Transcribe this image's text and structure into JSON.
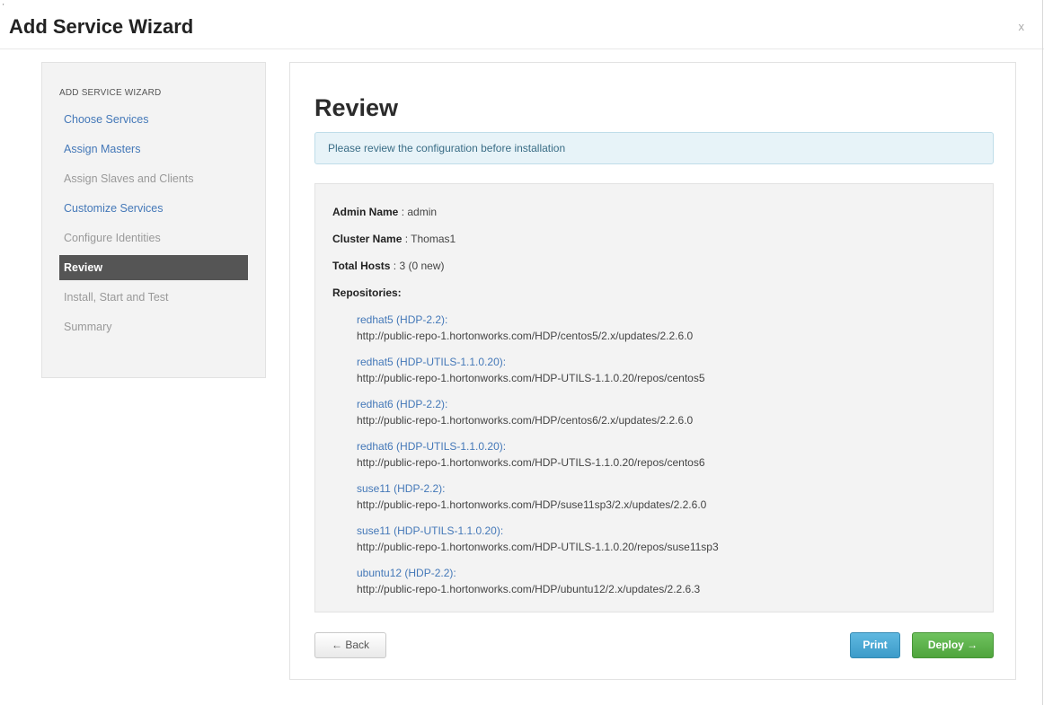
{
  "window": {
    "title": "Add Service Wizard",
    "close_label": "x",
    "corner_mark": "'"
  },
  "sidebar": {
    "header": "ADD SERVICE WIZARD",
    "items": [
      {
        "label": "Choose Services"
      },
      {
        "label": "Assign Masters"
      },
      {
        "label": "Assign Slaves and Clients"
      },
      {
        "label": "Customize Services"
      },
      {
        "label": "Configure Identities"
      },
      {
        "label": "Review"
      },
      {
        "label": "Install, Start and Test"
      },
      {
        "label": "Summary"
      }
    ]
  },
  "main": {
    "title": "Review",
    "alert": "Please review the configuration before installation",
    "summary": {
      "admin_label": "Admin Name",
      "admin_value": ": admin",
      "cluster_label": "Cluster Name",
      "cluster_value": ": Thomas1",
      "hosts_label": "Total Hosts",
      "hosts_value": ": 3 (0 new)",
      "repos_label": "Repositories:"
    },
    "repositories": [
      {
        "name": "redhat5 (HDP-2.2):",
        "url": "http://public-repo-1.hortonworks.com/HDP/centos5/2.x/updates/2.2.6.0"
      },
      {
        "name": "redhat5 (HDP-UTILS-1.1.0.20):",
        "url": "http://public-repo-1.hortonworks.com/HDP-UTILS-1.1.0.20/repos/centos5"
      },
      {
        "name": "redhat6 (HDP-2.2):",
        "url": "http://public-repo-1.hortonworks.com/HDP/centos6/2.x/updates/2.2.6.0"
      },
      {
        "name": "redhat6 (HDP-UTILS-1.1.0.20):",
        "url": "http://public-repo-1.hortonworks.com/HDP-UTILS-1.1.0.20/repos/centos6"
      },
      {
        "name": "suse11 (HDP-2.2):",
        "url": "http://public-repo-1.hortonworks.com/HDP/suse11sp3/2.x/updates/2.2.6.0"
      },
      {
        "name": "suse11 (HDP-UTILS-1.1.0.20):",
        "url": "http://public-repo-1.hortonworks.com/HDP-UTILS-1.1.0.20/repos/suse11sp3"
      },
      {
        "name": "ubuntu12 (HDP-2.2):",
        "url": "http://public-repo-1.hortonworks.com/HDP/ubuntu12/2.x/updates/2.2.6.3"
      }
    ],
    "buttons": {
      "back": "← Back",
      "print": "Print",
      "deploy": "Deploy →"
    }
  }
}
